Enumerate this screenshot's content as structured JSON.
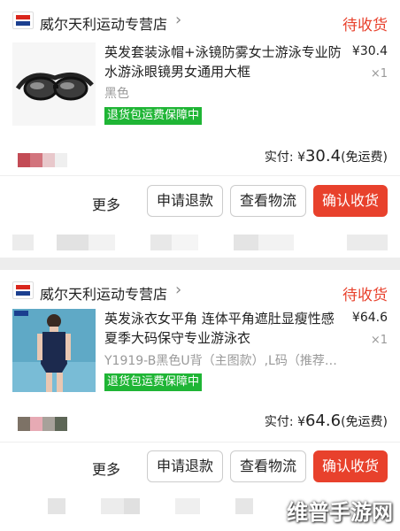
{
  "orders": [
    {
      "shop_name": "威尔天利运动专营店",
      "status": "待收货",
      "title": "英发套装泳帽+泳镜防雾女士游泳专业防水游泳眼镜男女通用大框",
      "sku": "黑色",
      "price": "¥30.4",
      "qty": "×1",
      "badge": "退货包运费保障中",
      "total_prefix": "实付: ¥",
      "total_amount": "30.4",
      "total_suffix": "(免运费)",
      "buttons": {
        "more": "更多",
        "refund": "申请退款",
        "logistics": "查看物流",
        "confirm": "确认收货"
      },
      "thumb_icon": "swim-goggles-icon",
      "pixel_colors": [
        "#c34b55",
        "#d2747d",
        "#e8c8cb",
        "#efefef"
      ]
    },
    {
      "shop_name": "威尔天利运动专营店",
      "status": "待收货",
      "title": "英发泳衣女平角 连体平角遮肚显瘦性感 夏季大码保守专业游泳衣",
      "sku": "Y1919-B黑色U背（主图款）,L码（推荐…",
      "price": "¥64.6",
      "qty": "×1",
      "badge": "退货包运费保障中",
      "total_prefix": "实付: ¥",
      "total_amount": "64.6",
      "total_suffix": "(免运费)",
      "buttons": {
        "more": "更多",
        "refund": "申请退款",
        "logistics": "查看物流",
        "confirm": "确认收货"
      },
      "thumb_icon": "swimsuit-model-icon",
      "pixel_colors": [
        "#7d7266",
        "#e7aab4",
        "#a7a19a",
        "#5d6656"
      ]
    }
  ],
  "watermark": "维普手游网",
  "colors": {
    "accent": "#e8412c",
    "badge": "#1fb535"
  }
}
